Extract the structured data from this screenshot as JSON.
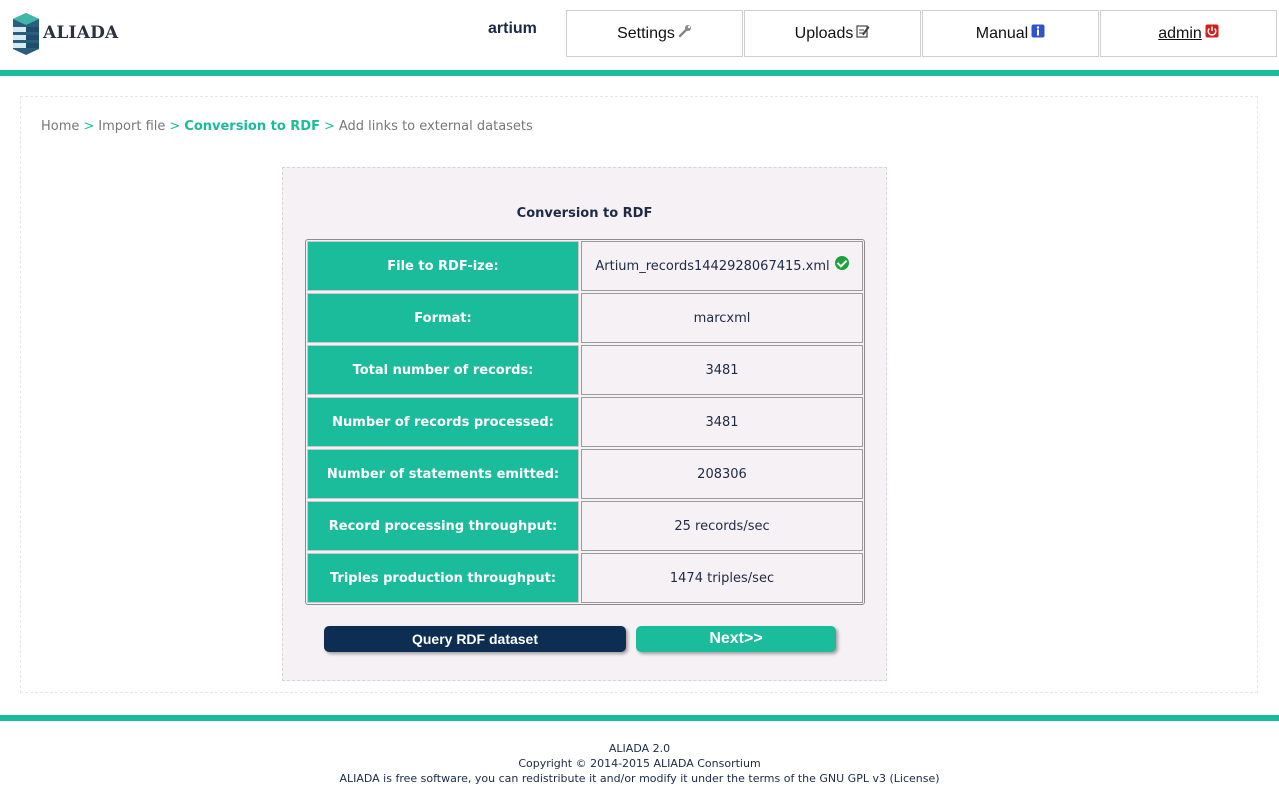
{
  "header": {
    "logo_text": "ALIADA",
    "organization": "artium",
    "nav": [
      {
        "label": "Settings",
        "icon": "wrench-icon"
      },
      {
        "label": "Uploads",
        "icon": "edit-icon"
      },
      {
        "label": "Manual",
        "icon": "info-icon"
      },
      {
        "label": "admin",
        "icon": "power-icon"
      }
    ]
  },
  "breadcrumb": {
    "items": [
      "Home",
      "Import file",
      "Conversion to RDF",
      "Add links to external datasets"
    ],
    "separator": ">"
  },
  "panel": {
    "title": "Conversion to RDF",
    "rows": [
      {
        "label": "File to RDF-ize:",
        "value": "Artium_records1442928067415.xml"
      },
      {
        "label": "Format:",
        "value": "marcxml"
      },
      {
        "label": "Total number of records:",
        "value": "3481"
      },
      {
        "label": "Number of records processed:",
        "value": "3481"
      },
      {
        "label": "Number of statements emitted:",
        "value": "208306"
      },
      {
        "label": "Record processing throughput:",
        "value": "25 records/sec"
      },
      {
        "label": "Triples production throughput:",
        "value": "1474 triples/sec"
      }
    ],
    "query_button": "Query RDF dataset",
    "next_button": "Next>>"
  },
  "footer": {
    "line1": "ALIADA 2.0",
    "line2": "Copyright © 2014-2015 ALIADA Consortium",
    "line3_prefix": "ALIADA is free software, you can redistribute it and/or modify it under the terms of the GNU GPL v3 (",
    "license_link": "License",
    "line3_suffix": ")"
  },
  "colors": {
    "accent": "#1bbc9b",
    "navy": "#0e2d52",
    "panel_bg": "#f6f1f4"
  }
}
